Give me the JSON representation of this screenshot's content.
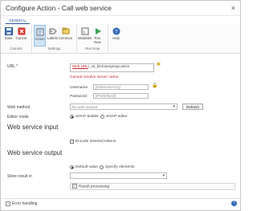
{
  "window": {
    "title": "Configure Action - Call web service",
    "close": "×"
  },
  "ribbon": {
    "tab": "GENERAL",
    "groups": [
      {
        "label": "Commit",
        "buttons": [
          {
            "label": "Save",
            "icon": "save-icon"
          },
          {
            "label": "Cancel",
            "icon": "cancel-icon"
          }
        ]
      },
      {
        "label": "Settings",
        "buttons": [
          {
            "label": "Action",
            "icon": "action-icon"
          },
          {
            "label": "Labels",
            "icon": "labels-icon"
          },
          {
            "label": "Common",
            "icon": "common-icon"
          }
        ]
      },
      {
        "label": "Run Now",
        "buttons": [
          {
            "label": "Variables",
            "icon": "variables-icon"
          },
          {
            "label": "Run Now",
            "icon": "run-now-icon"
          }
        ]
      },
      {
        "label": "",
        "buttons": [
          {
            "label": "Help",
            "icon": "help-icon"
          }
        ]
      }
    ]
  },
  "form": {
    "url_label": "URL *",
    "url_value_link": "Web URL",
    "url_value_rest": "/_vti_bin/usergroup.asmx",
    "url_error": "Cannot resolve server name.",
    "username_label": "Username",
    "username_value": "[NintexInvAcct]",
    "password_label": "Password",
    "password_value": "[Predefined]",
    "web_method_label": "Web method",
    "web_method_value": "No web service",
    "refresh_label": "Refresh",
    "editor_mode_label": "Editor mode",
    "editor_soap_builder": "SOAP builder",
    "editor_soap_editor": "SOAP editor",
    "web_service_input_heading": "Web service input",
    "encode_tokens_label": "Encode inserted tokens",
    "web_service_output_heading": "Web service output",
    "default_value_label": "Default value",
    "specify_elements_label": "Specify elements",
    "store_result_label": "Store result in",
    "store_result_value": "",
    "result_processing_label": "Result processing"
  },
  "footer": {
    "error_handling_label": "Error handling",
    "help_glyph": "?"
  },
  "colors": {
    "accent": "#2b579a",
    "error": "#c0262d"
  }
}
